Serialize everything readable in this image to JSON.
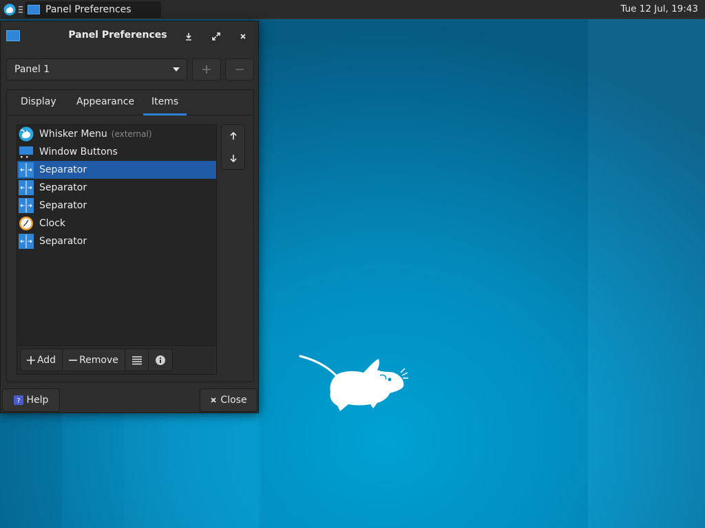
{
  "colors": {
    "accent": "#2e7fd6",
    "selection": "#1f5ba6",
    "panel_bg": "#2b2b2b",
    "window_bg": "#2d2d2d",
    "desktop": "#0490c4"
  },
  "top_panel": {
    "task_title": "Panel Preferences",
    "clock": "Tue 12 Jul, 19:43"
  },
  "window": {
    "title": "Panel Preferences",
    "panel_select": {
      "value": "Panel 1"
    },
    "add_panel_icon": "plus-icon",
    "remove_panel_icon": "minus-icon",
    "tabs": [
      {
        "label": "Display"
      },
      {
        "label": "Appearance"
      },
      {
        "label": "Items",
        "active": true
      }
    ],
    "items": [
      {
        "label": "Whisker Menu",
        "extra": "(external)",
        "icon": "whisker-menu-icon"
      },
      {
        "label": "Window Buttons",
        "icon": "window-buttons-icon"
      },
      {
        "label": "Separator",
        "icon": "separator-icon",
        "selected": true
      },
      {
        "label": "Separator",
        "icon": "separator-icon"
      },
      {
        "label": "Separator",
        "icon": "separator-icon"
      },
      {
        "label": "Clock",
        "icon": "clock-icon"
      },
      {
        "label": "Separator",
        "icon": "separator-icon"
      }
    ],
    "list_toolbar": {
      "add_label": "Add",
      "remove_label": "Remove"
    },
    "help_label": "Help",
    "close_label": "Close"
  }
}
